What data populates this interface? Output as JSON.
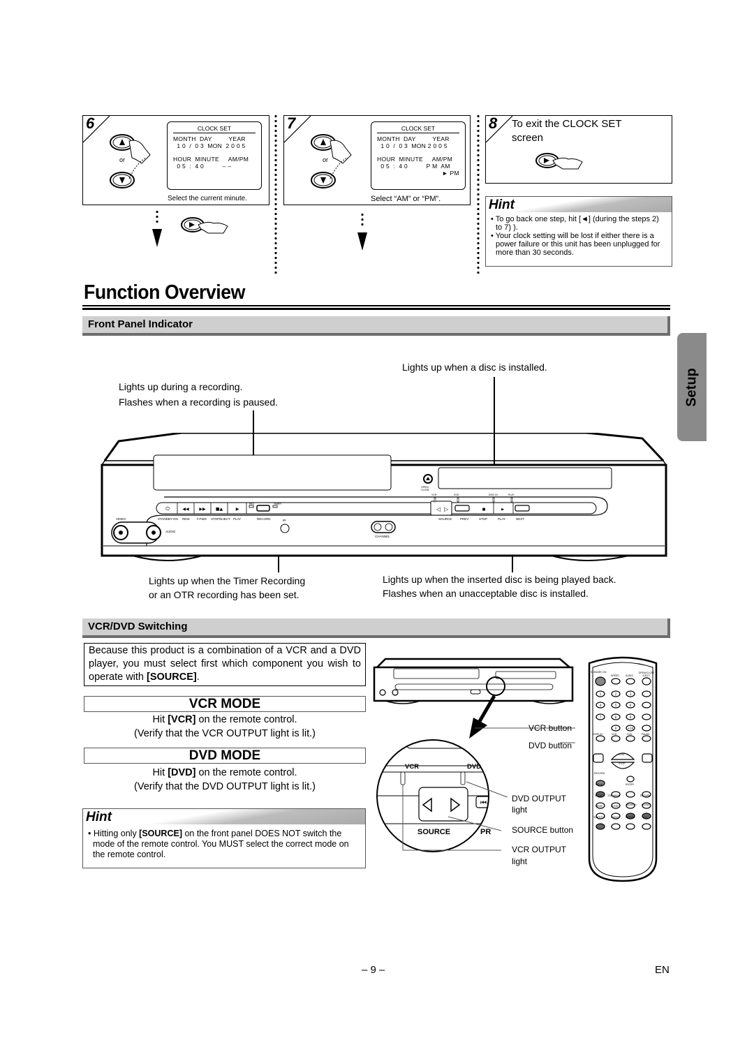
{
  "steps": [
    {
      "number": "6",
      "osd": {
        "title": "CLOCK SET",
        "row1_labels": "MONTH  DAY         YEAR",
        "row1_values": "  1 0  /  0 3  MON  2 0 0 5",
        "row2_labels": "HOUR  MINUTE     AM/PM",
        "row2_values": "  0 5  :  4 0          – –",
        "row3_values": ""
      },
      "caption": "Select the current minute.",
      "or_label": "or"
    },
    {
      "number": "7",
      "osd": {
        "title": "CLOCK SET",
        "row1_labels": "MONTH  DAY         YEAR",
        "row1_values": "  1 0  /  0 3  MON 2 0 0 5",
        "row2_labels": "HOUR  MINUTE     AM/PM",
        "row2_values": "  0 5  :  4 0          P M  AM",
        "row3_values": "                                      ► PM"
      },
      "caption": "Select “AM” or “PM”.",
      "or_label": "or"
    },
    {
      "number": "8",
      "text": "To exit the CLOCK SET screen"
    }
  ],
  "hint_top": {
    "title": "Hint",
    "items": [
      "To go back one step, hit [◄] (during the steps 2) to 7) ).",
      "Your clock setting will be lost if either there is a power failure or this unit has been unplugged for more than 30 seconds."
    ]
  },
  "page_title": "Function Overview",
  "side_tab": "Setup",
  "front_panel": {
    "heading": "Front Panel Indicator",
    "callouts": {
      "disc_in": "Lights up when a disc is installed.",
      "rec_line1": "Lights up during a recording.",
      "rec_line2": "Flashes when a recording is paused.",
      "timer_line1": "Lights up when the Timer Recording",
      "timer_line2": "or an OTR recording has been set.",
      "play_line1": "Lights up when the inserted disc is being played back.",
      "play_line2": "Flashes when an unacceptable disc is installed."
    },
    "device_labels": {
      "video": "VIDEO",
      "audio": "AUDIO",
      "standby": "STANDBY-ON",
      "rew": "REW",
      "ffwd": "F.FWD",
      "stop_eject": "STOP/EJECT",
      "play": "PLAY",
      "rec": "REC",
      "timer": "TIMER",
      "record": "RECORD",
      "ir": "IR",
      "channel": "CHANNEL",
      "open_close": "OPEN/ CLOSE",
      "vcr": "VCR",
      "dvd": "DVD",
      "disc_in": "DISC IN",
      "play_led": "PLAY",
      "source": "SOURCE",
      "prev": "PREV",
      "stop": "STOP",
      "play_dvd": "PLAY",
      "next": "NEXT"
    }
  },
  "switching": {
    "heading": "VCR/DVD Switching",
    "intro_prefix": "Because this product is a combination of a VCR and a DVD player, you must select first which component you wish to operate with ",
    "intro_bold": "[SOURCE]",
    "intro_suffix": ".",
    "vcr_mode": {
      "title": "VCR MODE",
      "line1_prefix": "Hit ",
      "line1_bold": "[VCR]",
      "line1_suffix": " on the remote control.",
      "line2": "(Verify that the VCR OUTPUT light is lit.)"
    },
    "dvd_mode": {
      "title": "DVD MODE",
      "line1_prefix": "Hit ",
      "line1_bold": "[DVD]",
      "line1_suffix": " on the remote control.",
      "line2": "(Verify that the DVD OUTPUT light is lit.)"
    },
    "hint": {
      "title": "Hint",
      "item_prefix": "Hitting only ",
      "item_bold": "[SOURCE]",
      "item_suffix": " on the front panel DOES NOT switch the mode of the remote control. You MUST select the correct mode on the remote control."
    },
    "detail_labels": {
      "vcr": "VCR",
      "dvd": "DVD",
      "source": "SOURCE",
      "prev_partial": "PR"
    },
    "callouts": {
      "vcr_button": "VCR button",
      "dvd_button": "DVD button",
      "dvd_output_1": "DVD OUTPUT",
      "dvd_output_2": "light",
      "source_button": "SOURCE button",
      "vcr_output_1": "VCR OUTPUT",
      "vcr_output_2": "light"
    },
    "remote_labels": {
      "standby": "STANDBY-ON",
      "speed": "SPEED",
      "audio": "AUDIO",
      "open_close": "OPEN/CLOSE EJECT",
      "skip_ch": "SKIP/CH",
      "vcr_tv": "VCR/TV",
      "slow": "SLOW",
      "display": "DISPLAY",
      "vcr": "VCR",
      "dvd": "DVD",
      "pause": "PAUSE",
      "play": "PLAY",
      "stop": "STOP",
      "record": "RECORD",
      "menu": "MENU",
      "enter": "ENTER",
      "setup": "SETUP",
      "top_menu": "TOP MENU",
      "return": "RETURN",
      "mode": "MODE",
      "zoom": "ZOOM",
      "search": "SEARCH",
      "clear": "CLEAR",
      "subtitle": "SUBTITLE",
      "angle": "ANGLE",
      "repeat": "REPEAT",
      "ab": "A-B",
      "digits": [
        "1",
        "2",
        "3",
        "4",
        "5",
        "6",
        "7",
        "8",
        "9",
        "0",
        "+10"
      ]
    }
  },
  "footer": {
    "page_number": "– 9 –",
    "language": "EN"
  }
}
